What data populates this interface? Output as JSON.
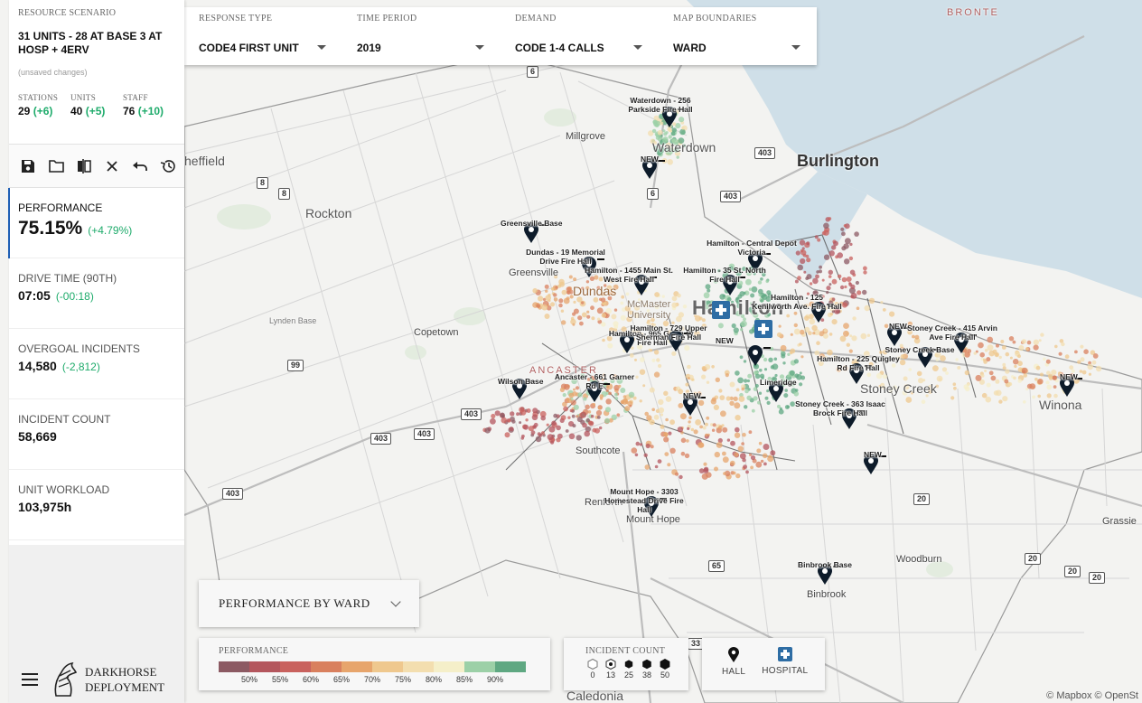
{
  "filters": [
    {
      "label": "RESPONSE TYPE",
      "value": "CODE4 FIRST UNIT"
    },
    {
      "label": "TIME PERIOD",
      "value": "2019"
    },
    {
      "label": "DEMAND",
      "value": "CODE 1-4 CALLS"
    },
    {
      "label": "MAP BOUNDARIES",
      "value": "WARD"
    }
  ],
  "scenario": {
    "label": "RESOURCE SCENARIO",
    "name": "31 UNITS - 28 AT BASE 3 AT HOSP + 4ERV",
    "status": "(unsaved changes)",
    "stats": [
      {
        "label": "STATIONS",
        "value": "29",
        "delta": "(+6)"
      },
      {
        "label": "UNITS",
        "value": "40",
        "delta": "(+5)"
      },
      {
        "label": "STAFF",
        "value": "76",
        "delta": "(+10)"
      }
    ]
  },
  "toolbar": {
    "icons": [
      "save-icon",
      "folder-open-icon",
      "compare-icon",
      "close-icon",
      "undo-icon",
      "history-icon"
    ]
  },
  "metrics": [
    {
      "label": "PERFORMANCE",
      "value": "75.15%",
      "delta": "(+4.79%)",
      "active": true
    },
    {
      "label": "DRIVE TIME (90TH)",
      "value": "07:05",
      "delta": "(-00:18)"
    },
    {
      "label": "OVERGOAL INCIDENTS",
      "value": "14,580",
      "delta": "(-2,812)"
    },
    {
      "label": "INCIDENT COUNT",
      "value": "58,669",
      "delta": ""
    },
    {
      "label": "UNIT WORKLOAD",
      "value": "103,975h",
      "delta": ""
    }
  ],
  "brand": {
    "line1": "DARKHORSE",
    "line2": "DEPLOYMENT"
  },
  "ward_dropdown": {
    "label": "PERFORMANCE BY WARD"
  },
  "legend_performance": {
    "title": "PERFORMANCE",
    "colors": [
      "#8c5a63",
      "#b4565d",
      "#c9625e",
      "#d9805e",
      "#e7a56c",
      "#efc88e",
      "#f3deaf",
      "#f5efc9",
      "#9cd0a7",
      "#5fa882"
    ],
    "ticks": [
      "50%",
      "55%",
      "60%",
      "65%",
      "70%",
      "75%",
      "80%",
      "85%",
      "90%"
    ]
  },
  "legend_incidents": {
    "title": "INCIDENT COUNT",
    "ticks": [
      "0",
      "13",
      "25",
      "38",
      "50"
    ]
  },
  "legend_icons": {
    "hall": "HALL",
    "hospital": "HOSPITAL"
  },
  "map": {
    "places": [
      {
        "text": "BRONTE",
        "cls": "ward"
      },
      {
        "text": "Burlington",
        "cls": "big"
      },
      {
        "text": "Waterdown",
        "cls": "med"
      },
      {
        "text": "Millgrove",
        "cls": ""
      },
      {
        "text": "heffield",
        "cls": ""
      },
      {
        "text": "Rockton",
        "cls": "med"
      },
      {
        "text": "Greensville",
        "cls": ""
      },
      {
        "text": "Dundas",
        "cls": "med"
      },
      {
        "text": "McMaster University",
        "cls": ""
      },
      {
        "text": "Hamilton",
        "cls": "city"
      },
      {
        "text": "Copetown",
        "cls": ""
      },
      {
        "text": "ANCASTER",
        "cls": "ward"
      },
      {
        "text": "Stoney Creek",
        "cls": "med"
      },
      {
        "text": "Winona",
        "cls": "med"
      },
      {
        "text": "Southcote",
        "cls": ""
      },
      {
        "text": "Renforth",
        "cls": ""
      },
      {
        "text": "Mount Hope",
        "cls": ""
      },
      {
        "text": "Grassie",
        "cls": ""
      },
      {
        "text": "Woodburn",
        "cls": ""
      },
      {
        "text": "Binbrook",
        "cls": ""
      },
      {
        "text": "Caledonia",
        "cls": "med"
      },
      {
        "text": "Lynden Base",
        "cls": ""
      }
    ],
    "shields": [
      "6",
      "403",
      "403",
      "8",
      "8",
      "6",
      "99",
      "403",
      "403",
      "403",
      "403",
      "20",
      "65",
      "20",
      "20",
      "20",
      "33"
    ],
    "stations": [
      {
        "label": "Waterdown - 256 Parkside Fire Hall"
      },
      {
        "label": "NEW"
      },
      {
        "label": "Greensville Base"
      },
      {
        "label": "Dundas - 19 Memorial Drive Fire Hall"
      },
      {
        "label": "Hamilton - 1455 Main St. West Fire Hall"
      },
      {
        "label": "Hamilton - Central Depot Victoria"
      },
      {
        "label": "Hamilton - 35 St. North Fire Hall"
      },
      {
        "label": "Hamilton - 125 Kenilworth Ave. Fire Hall"
      },
      {
        "label": "NEW"
      },
      {
        "label": "Hamilton - 965 Garth St. Fire Hall"
      },
      {
        "label": "Hamilton - 729 Upper Sherman Fire Hall"
      },
      {
        "label": "NEW"
      },
      {
        "label": "Stoney Creek - 415 Arvin Ave Fire Hall"
      },
      {
        "label": "Stoney Creek Base"
      },
      {
        "label": "Hamilton - 225 Quigley Rd Fire Hall"
      },
      {
        "label": "Wilson Base"
      },
      {
        "label": "Ancaster - 661 Garner Rd E"
      },
      {
        "label": "NEW"
      },
      {
        "label": "Limeridge"
      },
      {
        "label": "Stoney Creek - 363 Isaac Brock Fire Hall"
      },
      {
        "label": "NEW"
      },
      {
        "label": "NEW"
      },
      {
        "label": "Mount Hope - 3303 Homestead Drive Fire Hall"
      },
      {
        "label": "Binbrook Base"
      }
    ],
    "hospitals": [
      "St Joseph's Hospital",
      "Juravinski Hospital"
    ],
    "attribution": "© Mapbox © OpenSt"
  }
}
